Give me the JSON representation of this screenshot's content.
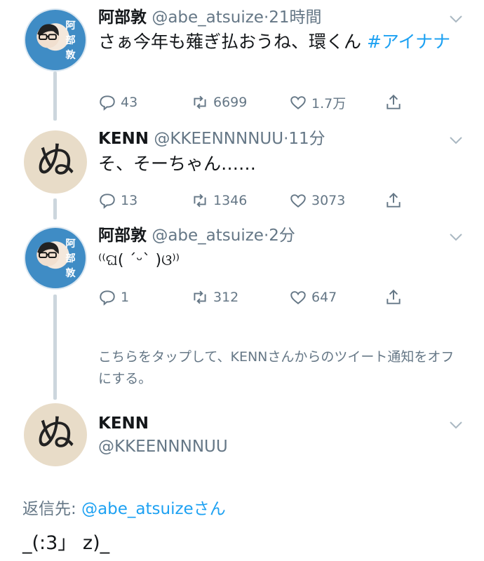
{
  "tweets": [
    {
      "name": "阿部敦",
      "handle": "@abe_atsuize",
      "dot": "·",
      "time": "21時間",
      "text_plain": "さぁ今年も薙ぎ払おうね、環くん ",
      "hashtag": "#アイナナ",
      "reply_count": "43",
      "retweet_count": "6699",
      "like_count": "1.7万",
      "avatar_text": [
        "阿",
        "部",
        "敦"
      ]
    },
    {
      "name": "KENN",
      "handle": "@KKEENNNNUU",
      "dot": "·",
      "time": "11分",
      "text_plain": "そ、そーちゃん……",
      "reply_count": "13",
      "retweet_count": "1346",
      "like_count": "3073",
      "avatar_text": "ぬ"
    },
    {
      "name": "阿部敦",
      "handle": "@abe_atsuize",
      "dot": "·",
      "time": "2分",
      "text_plain": "⁽⁽ଘ( ˊᵕˋ )ଓ⁾⁾",
      "reply_count": "1",
      "retweet_count": "312",
      "like_count": "647",
      "avatar_text": [
        "阿",
        "部",
        "敦"
      ]
    }
  ],
  "notification_text": "こちらをタップして、KENNさんからのツイート通知をオフにする。",
  "focused": {
    "name": "KENN",
    "handle": "@KKEENNNNUU",
    "avatar_text": "ぬ",
    "reply_prefix": "返信先: ",
    "reply_mention": "@abe_atsuize",
    "reply_suffix": "さん",
    "text": "_(:3」 z)_"
  },
  "colors": {
    "accent": "#1da1f2",
    "secondary_text": "#657786",
    "thread_line": "#ccd6dd"
  },
  "icons": [
    "reply-icon",
    "retweet-icon",
    "like-icon",
    "share-icon",
    "chevron-down-icon"
  ]
}
